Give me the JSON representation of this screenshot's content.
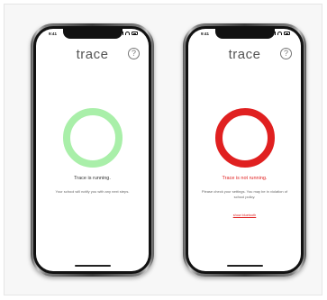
{
  "phones": [
    {
      "status_time": "9:41",
      "logo": "trace",
      "help_icon_text": "?",
      "ring_color": "#a9efa9",
      "status_text": "Trace is running.",
      "status_color": "#333333",
      "description": "Your school will notify you with any next steps.",
      "link": ""
    },
    {
      "status_time": "9:41",
      "logo": "trace",
      "help_icon_text": "?",
      "ring_color": "#e02020",
      "status_text": "Trace is not running.",
      "status_color": "#e02020",
      "description": "Please check your settings. You may be in violation of school policy.",
      "link": "show bluetooth",
      "link_color": "#e02020"
    }
  ]
}
